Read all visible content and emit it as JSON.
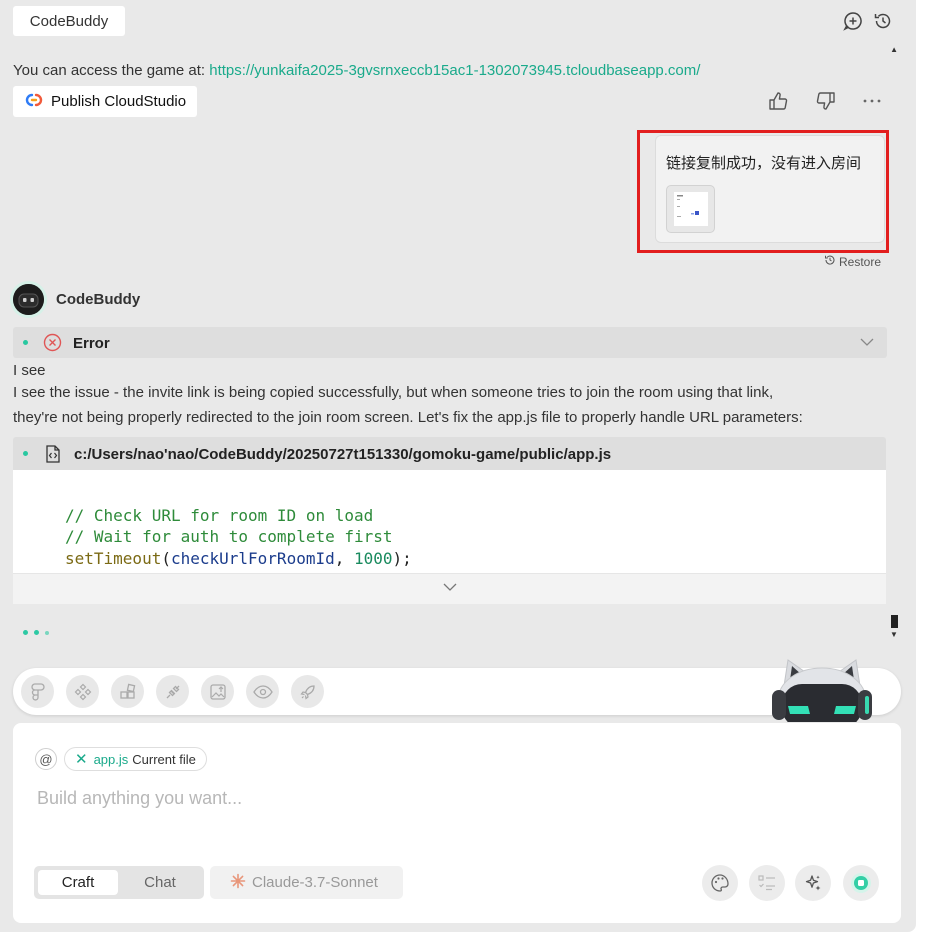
{
  "header": {
    "tab_title": "CodeBuddy",
    "icons": [
      "new-chat-icon",
      "history-icon"
    ]
  },
  "message1": {
    "access_prefix": "You can access the game at: ",
    "access_url": "https://yunkaifa2025-3gvsrnxeccb15ac1-1302073945.tcloudbaseapp.com/",
    "publish_label": "Publish CloudStudio",
    "feedback_icons": [
      "thumbs-up-icon",
      "thumbs-down-icon",
      "more-icon"
    ]
  },
  "user_message": {
    "text": "链接复制成功，没有进入房间",
    "restore_label": "Restore"
  },
  "assistant": {
    "name": "CodeBuddy",
    "error_label": "Error",
    "line1": "I see",
    "line2": "I see the issue - the invite link is being copied successfully, but when someone tries to join the room using that link,",
    "line3": "they're not being properly redirected to the join room screen. Let's fix the app.js file to properly handle URL parameters:",
    "file_path": "c:/Users/nao'nao/CodeBuddy/20250727t151330/gomoku-game/public/app.js",
    "code": {
      "comment1": "// Check URL for room ID on load",
      "comment2": "// Wait for auth to complete first",
      "fn": "setTimeout",
      "open": "(",
      "arg": "checkUrlForRoomId",
      "sep": ", ",
      "num": "1000",
      "close": ");"
    }
  },
  "toolbar": {
    "tools": [
      "figma-icon",
      "components-icon",
      "blocks-icon",
      "plugin-icon",
      "image-upload-icon",
      "preview-icon",
      "deploy-rocket-icon"
    ]
  },
  "input": {
    "at_symbol": "@",
    "file_chip": {
      "name": "app.js",
      "suffix": "Current file"
    },
    "placeholder": "Build anything you want...",
    "modes": {
      "active": "Craft",
      "inactive": "Chat"
    },
    "model": "Claude-3.7-Sonnet"
  },
  "colors": {
    "accent": "#1aaa8b",
    "highlight_box": "#e21e1e",
    "error": "#e05555",
    "panel_bg": "#e9e9e9"
  }
}
